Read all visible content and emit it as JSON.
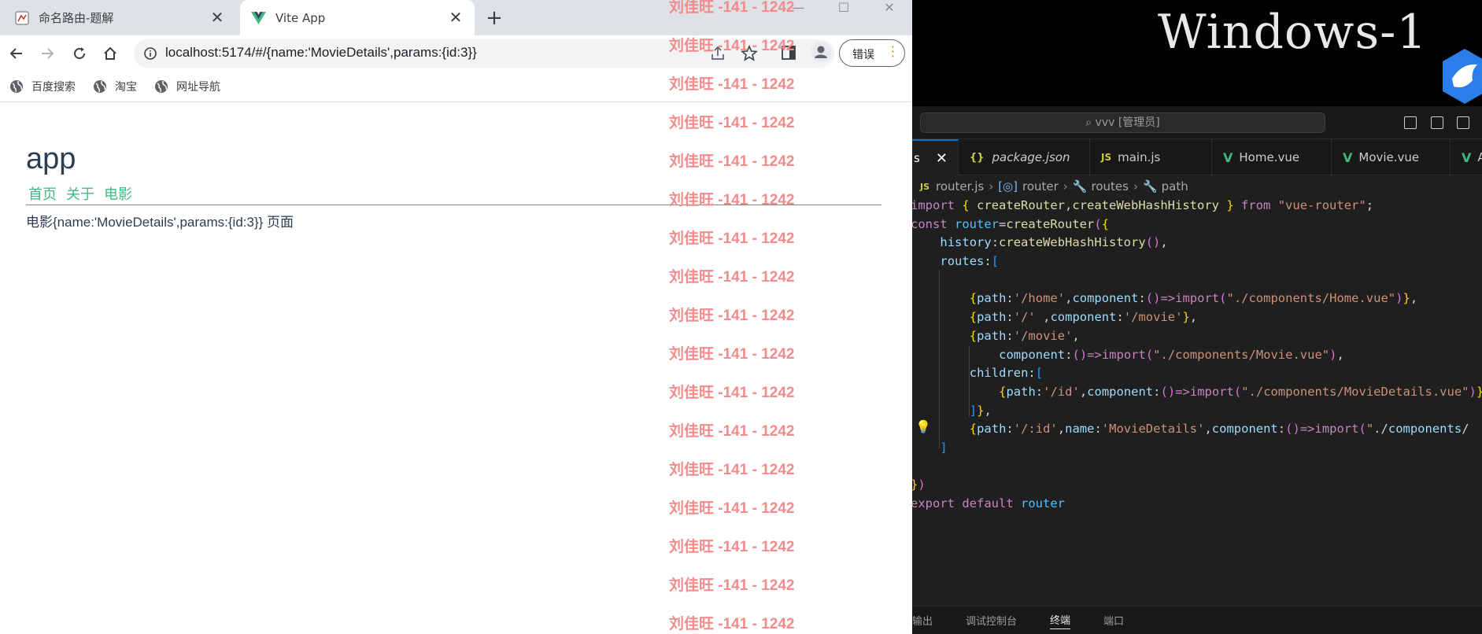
{
  "browser": {
    "tabs": [
      {
        "title": "命名路由-题解",
        "close": "✕"
      },
      {
        "title": "Vite App",
        "close": "✕"
      }
    ],
    "new_tab": "+",
    "window_controls": {
      "minimize": "—",
      "maximize": "☐",
      "close": "✕"
    },
    "url": {
      "host": "localhost",
      "rest": ":5174/#/{name:'MovieDetails',params:{id:3}}"
    },
    "error_button": "错误",
    "bookmarks": [
      "百度搜索",
      "淘宝",
      "网址导航"
    ]
  },
  "page": {
    "app_title": "app",
    "nav": [
      "首页",
      "关于",
      "电影"
    ],
    "route_text": "电影{name:'MovieDetails',params:{id:3}} 页面"
  },
  "watermark": {
    "text": "刘佳旺 -141 - 1242",
    "count": 17
  },
  "desktop": {
    "banner_text": "Windows-1"
  },
  "vscode": {
    "command_search": "vvv [管理员]",
    "tabs": [
      {
        "label": "s",
        "kind": "close",
        "close": "✕"
      },
      {
        "label": "package.json",
        "kind": "json",
        "icon": "{}"
      },
      {
        "label": "main.js",
        "kind": "js",
        "icon": "JS"
      },
      {
        "label": "Home.vue",
        "kind": "vue",
        "icon": "V"
      },
      {
        "label": "Movie.vue",
        "kind": "vue",
        "icon": "V"
      },
      {
        "label": "A",
        "kind": "vue",
        "icon": "V"
      }
    ],
    "breadcrumbs": {
      "file_icon": "JS",
      "file": "router.js",
      "b1": "router",
      "b2": "routes",
      "b3": "path",
      "sep": "›"
    },
    "code_lines": [
      "import { createRouter,createWebHashHistory } from \"vue-router\";",
      "const router=createRouter({",
      "    history:createWebHashHistory(),",
      "    routes:[",
      "",
      "        {path:'/home',component:()=>import(\"./components/Home.vue\")},",
      "        {path:'/' ,component:'/movie'},",
      "        {path:'/movie',",
      "            component:()=>import(\"./components/Movie.vue\"),",
      "        children:[",
      "            {path:'/id',component:()=>import(\"./components/MovieDetails.vue\")}",
      "        ]},",
      "        {path:'/:id',name:'MovieDetails',component:()=>import(\"./components/",
      "    ]",
      "",
      "})",
      "export default router"
    ],
    "panel_tabs": [
      "输出",
      "调试控制台",
      "终端",
      "端口"
    ]
  },
  "colors": {
    "accent_green": "#42b983",
    "watermark": "#f28b8b",
    "vscode_bg": "#1f1f1f"
  }
}
